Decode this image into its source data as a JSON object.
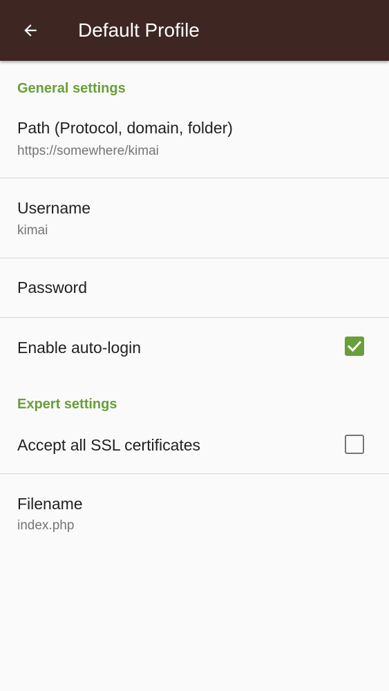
{
  "appbar": {
    "title": "Default Profile",
    "back_icon": "arrow-back-icon"
  },
  "colors": {
    "appbar_bg": "#3e2723",
    "accent": "#689f38",
    "background": "#fafafa"
  },
  "sections": {
    "general": {
      "header": "General settings",
      "path": {
        "title": "Path (Protocol, domain, folder)",
        "summary": "https://somewhere/kimai"
      },
      "username": {
        "title": "Username",
        "summary": "kimai"
      },
      "password": {
        "title": "Password"
      },
      "auto_login": {
        "title": "Enable auto-login",
        "checked": true
      }
    },
    "expert": {
      "header": "Expert settings",
      "ssl": {
        "title": "Accept all SSL certificates",
        "checked": false
      },
      "filename": {
        "title": "Filename",
        "summary": "index.php"
      }
    }
  }
}
